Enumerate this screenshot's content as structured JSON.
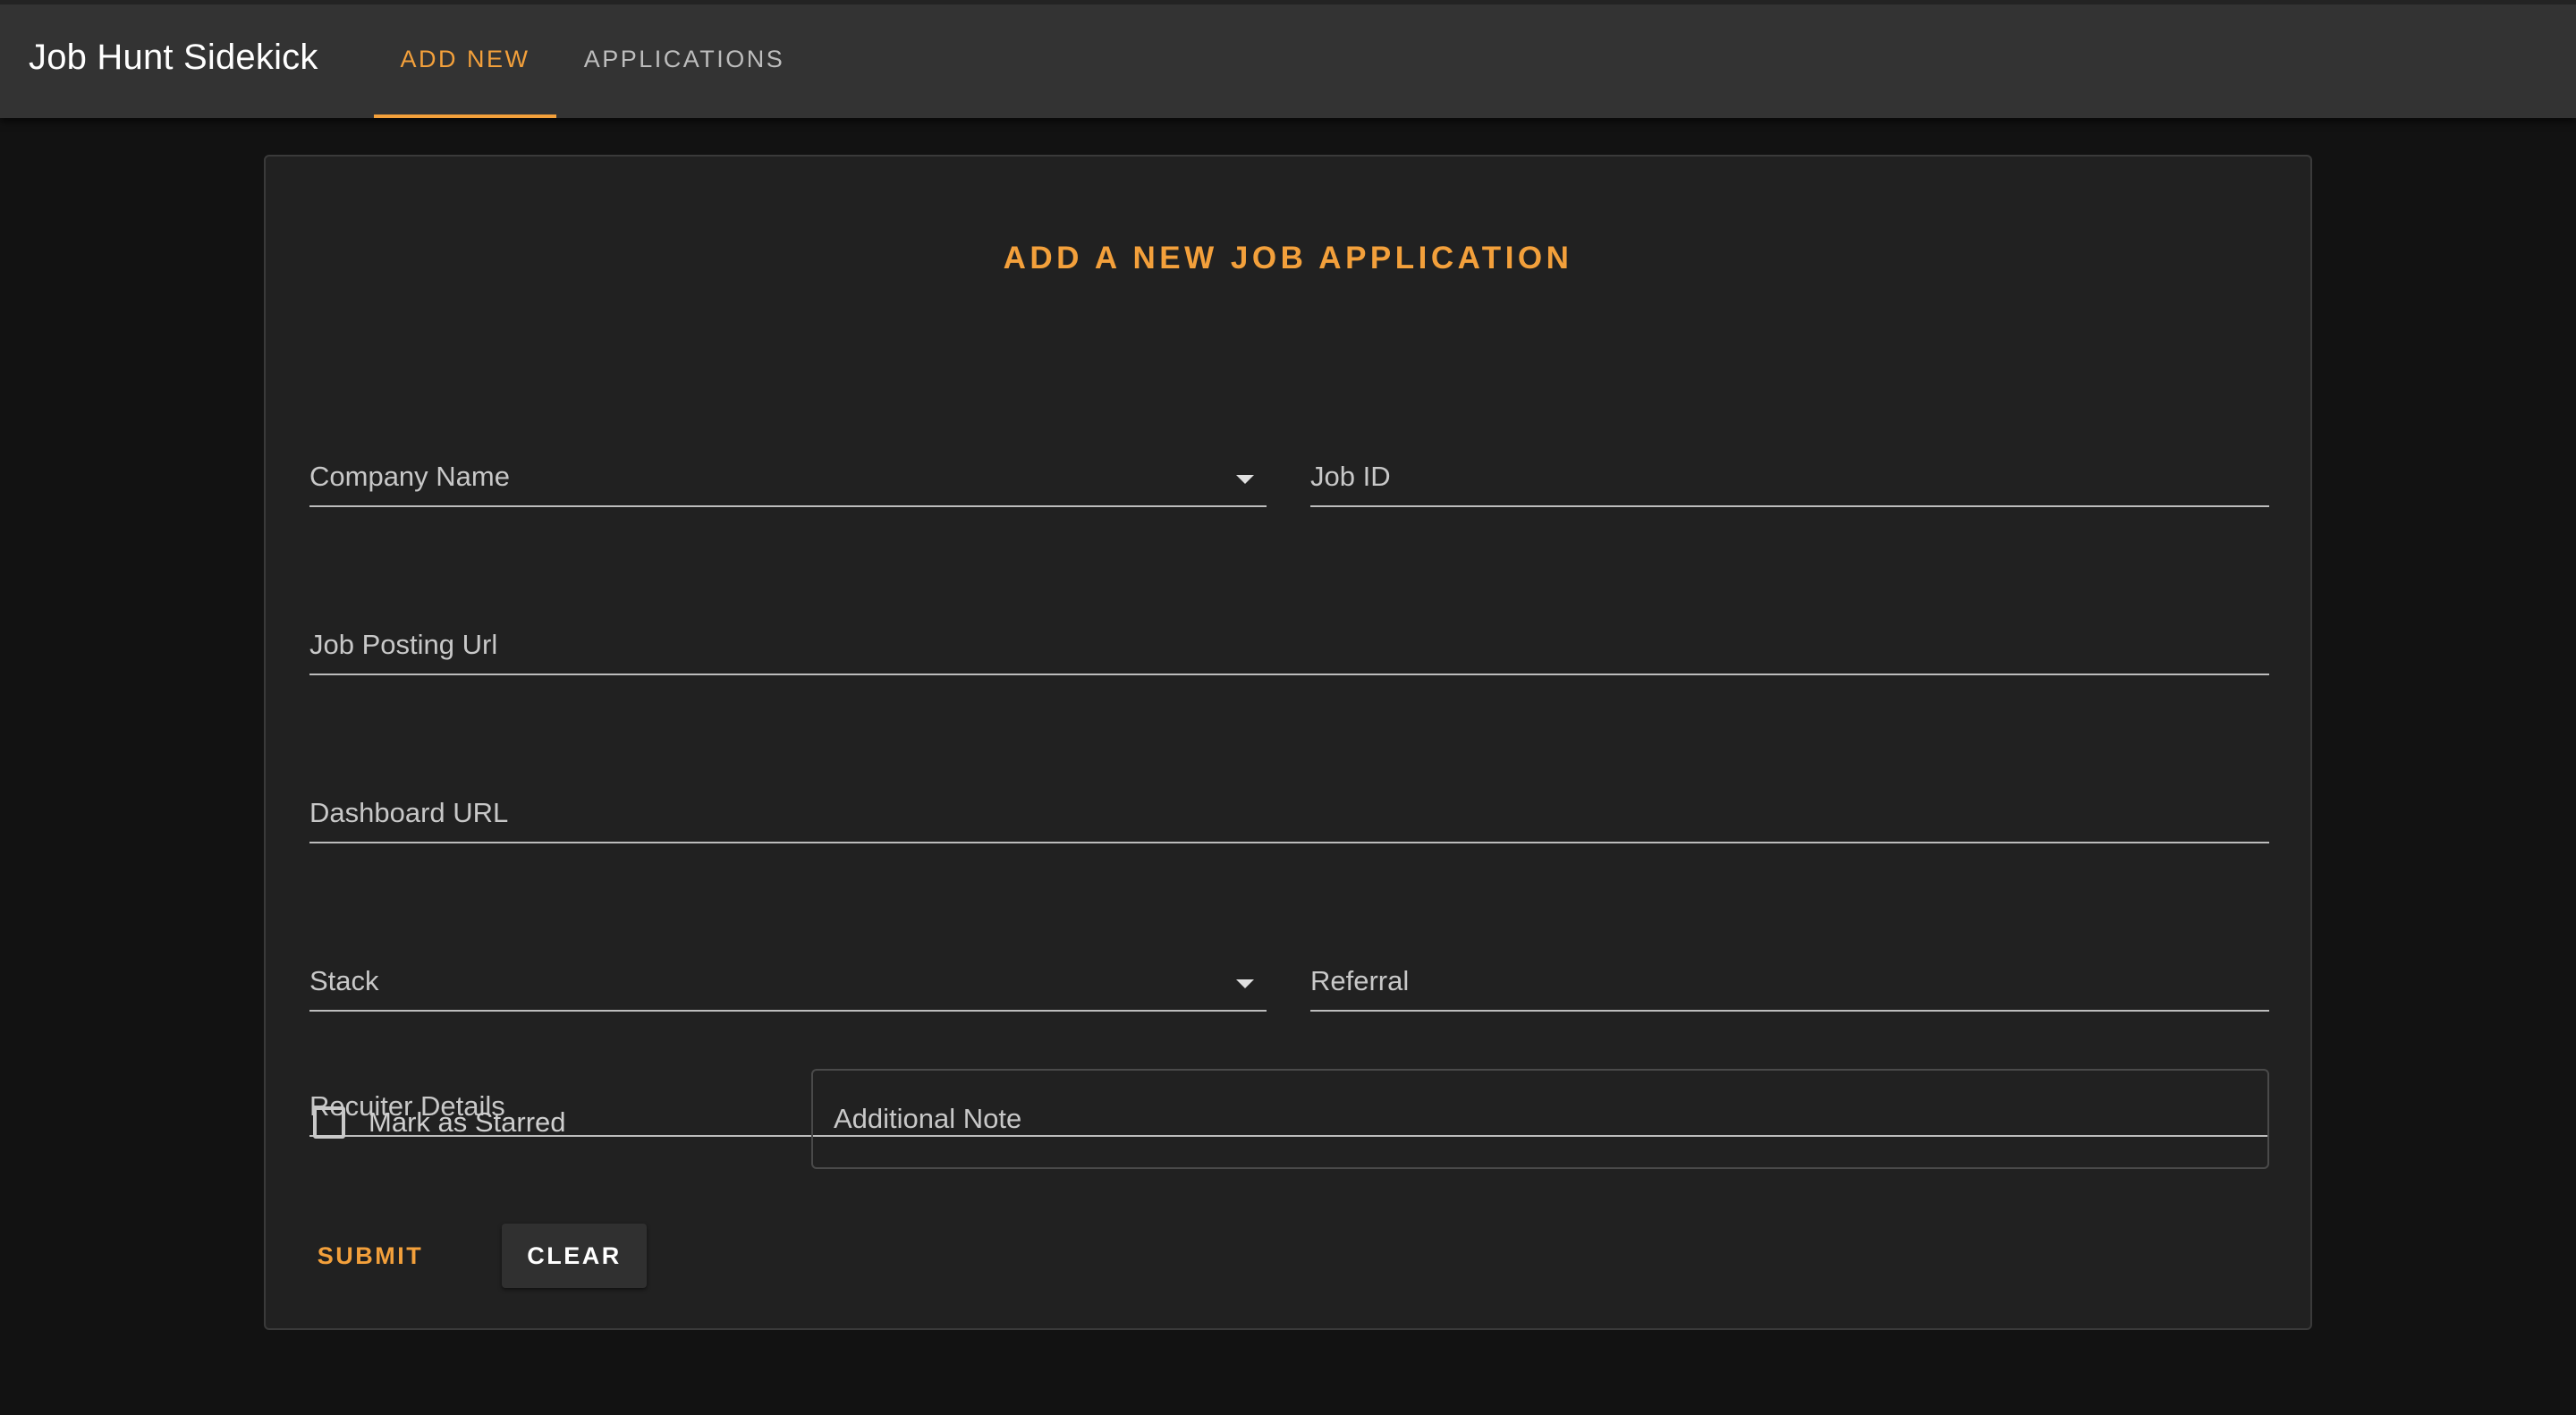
{
  "app": {
    "title": "Job Hunt Sidekick",
    "tabs": [
      {
        "label": "ADD NEW",
        "active": true
      },
      {
        "label": "APPLICATIONS",
        "active": false
      }
    ]
  },
  "form": {
    "title": "ADD A NEW JOB APPLICATION",
    "fields": {
      "company_name": {
        "label": "Company Name",
        "value": ""
      },
      "job_id": {
        "label": "Job ID",
        "value": ""
      },
      "job_posting_url": {
        "label": "Job Posting Url",
        "value": ""
      },
      "dashboard_url": {
        "label": "Dashboard URL",
        "value": ""
      },
      "stack": {
        "label": "Stack",
        "value": ""
      },
      "referral": {
        "label": "Referral",
        "value": ""
      },
      "recruiter_details": {
        "label": "Recuiter Details",
        "value": ""
      },
      "additional_note": {
        "label": "Additional Note",
        "value": ""
      }
    },
    "starred": {
      "label": "Mark as Starred",
      "checked": false
    },
    "buttons": {
      "submit": "SUBMIT",
      "clear": "CLEAR"
    }
  },
  "colors": {
    "accent": "#f3a03b",
    "appbar": "#333333",
    "card": "#212121",
    "background": "#121212"
  },
  "icons": {
    "dropdown": "caret-down-icon",
    "checkbox": "checkbox-unchecked-icon"
  }
}
